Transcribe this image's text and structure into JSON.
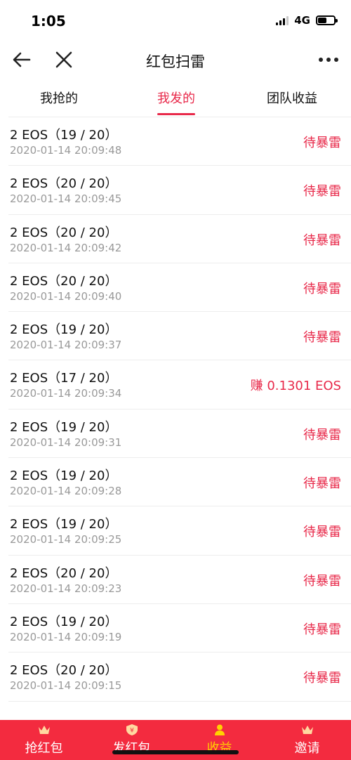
{
  "status": {
    "time": "1:05",
    "network": "4G"
  },
  "nav": {
    "title": "红包扫雷"
  },
  "tabs": [
    {
      "label": "我抢的"
    },
    {
      "label": "我发的"
    },
    {
      "label": "团队收益"
    }
  ],
  "rows": [
    {
      "title": "2 EOS（19 / 20）",
      "time": "2020-01-14 20:09:48",
      "status": "待暴雷"
    },
    {
      "title": "2 EOS（20 / 20）",
      "time": "2020-01-14 20:09:45",
      "status": "待暴雷"
    },
    {
      "title": "2 EOS（20 / 20）",
      "time": "2020-01-14 20:09:42",
      "status": "待暴雷"
    },
    {
      "title": "2 EOS（20 / 20）",
      "time": "2020-01-14 20:09:40",
      "status": "待暴雷"
    },
    {
      "title": "2 EOS（19 / 20）",
      "time": "2020-01-14 20:09:37",
      "status": "待暴雷"
    },
    {
      "title": "2 EOS（17 / 20）",
      "time": "2020-01-14 20:09:34",
      "status": "赚 0.1301 EOS"
    },
    {
      "title": "2 EOS（19 / 20）",
      "time": "2020-01-14 20:09:31",
      "status": "待暴雷"
    },
    {
      "title": "2 EOS（19 / 20）",
      "time": "2020-01-14 20:09:28",
      "status": "待暴雷"
    },
    {
      "title": "2 EOS（19 / 20）",
      "time": "2020-01-14 20:09:25",
      "status": "待暴雷"
    },
    {
      "title": "2 EOS（20 / 20）",
      "time": "2020-01-14 20:09:23",
      "status": "待暴雷"
    },
    {
      "title": "2 EOS（19 / 20）",
      "time": "2020-01-14 20:09:19",
      "status": "待暴雷"
    },
    {
      "title": "2 EOS（20 / 20）",
      "time": "2020-01-14 20:09:15",
      "status": "待暴雷"
    }
  ],
  "bottom_tabs": [
    {
      "label": "抢红包",
      "icon": "crown-icon"
    },
    {
      "label": "发红包",
      "icon": "shield-yen-icon"
    },
    {
      "label": "收益",
      "icon": "person-icon"
    },
    {
      "label": "邀请",
      "icon": "crown-icon"
    }
  ],
  "colors": {
    "accent": "#e8294a",
    "bottom_bar": "#f32b3f",
    "bottom_active": "#ffd200"
  }
}
